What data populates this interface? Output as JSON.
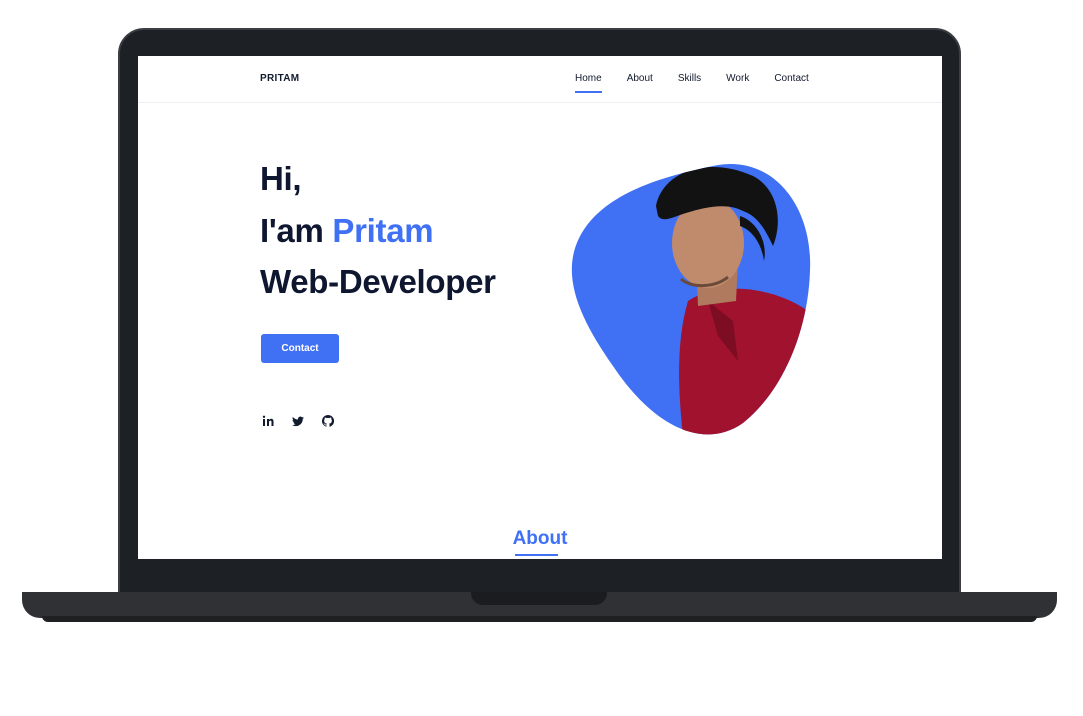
{
  "header": {
    "logo": "PRITAM",
    "nav": [
      "Home",
      "About",
      "Skills",
      "Work",
      "Contact"
    ],
    "active": "Home"
  },
  "hero": {
    "greeting": "Hi,",
    "intro_prefix": "I'am",
    "name": "Pritam",
    "role": "Web-Developer",
    "cta_label": "Contact"
  },
  "socials": [
    "linkedin-icon",
    "twitter-icon",
    "github-icon"
  ],
  "about": {
    "title": "About"
  },
  "colors": {
    "accent": "#4070f4",
    "text": "#0e1630",
    "frame": "#1d2024"
  }
}
